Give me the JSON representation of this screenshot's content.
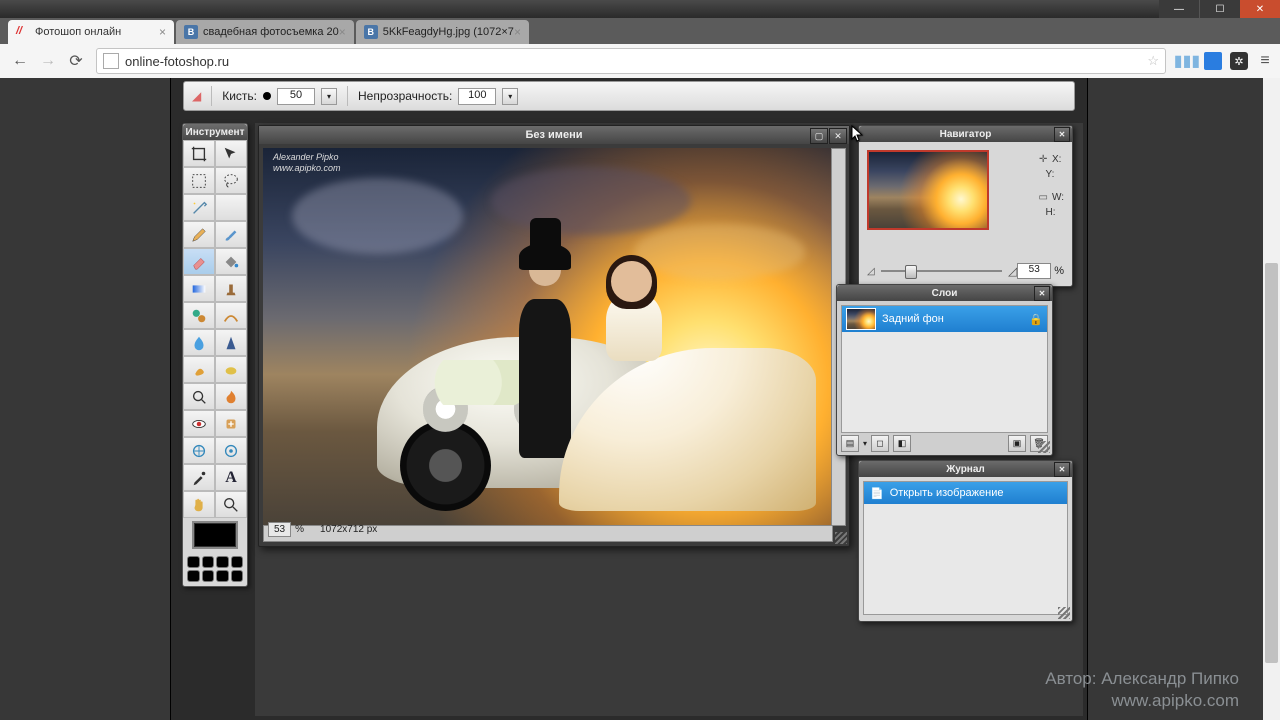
{
  "browser": {
    "tabs": [
      {
        "title": "Фотошоп онлайн",
        "favicon": "double-slash"
      },
      {
        "title": "свадебная фотосъемка 20",
        "favicon": "vk"
      },
      {
        "title": "5KkFeagdyHg.jpg (1072×7",
        "favicon": "vk"
      }
    ],
    "url": "online-fotoshop.ru"
  },
  "options_bar": {
    "brush_label": "Кисть:",
    "brush_size": "50",
    "opacity_label": "Непрозрачность:",
    "opacity_value": "100"
  },
  "tools_panel": {
    "title": "Инструмент"
  },
  "document": {
    "title": "Без имени",
    "zoom": "53",
    "zoom_unit": "%",
    "dimensions": "1072x712 px",
    "image_credit_line1": "Alexander Pipko",
    "image_credit_line2": "www.apipko.com"
  },
  "navigator": {
    "title": "Навигатор",
    "x_lbl": "X:",
    "y_lbl": "Y:",
    "w_lbl": "W:",
    "h_lbl": "H:",
    "zoom_value": "53",
    "zoom_unit": "%"
  },
  "layers": {
    "title": "Слои",
    "items": [
      {
        "name": "Задний фон",
        "locked": true
      }
    ]
  },
  "history": {
    "title": "Журнал",
    "items": [
      {
        "name": "Открыть изображение"
      }
    ]
  },
  "watermark": {
    "line1": "Автор: Александр Пипко",
    "line2": "www.apipko.com"
  }
}
